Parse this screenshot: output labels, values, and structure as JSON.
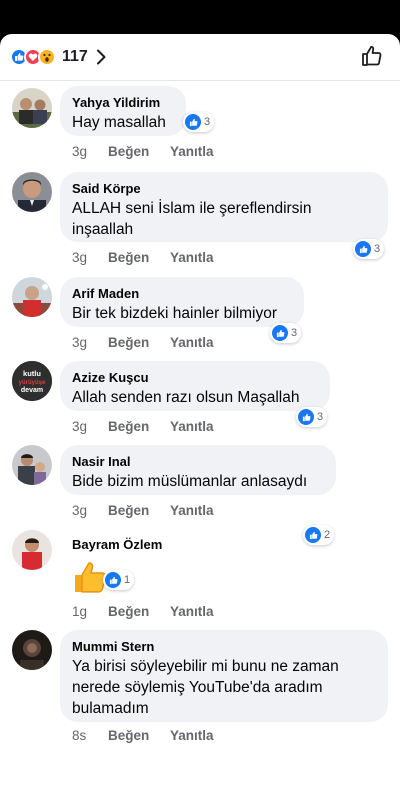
{
  "header": {
    "reaction_count": "117"
  },
  "comments": [
    {
      "name": "Yahya Yildirim",
      "text": "Hay masallah",
      "time": "3g",
      "like": "Beğen",
      "reply": "Yanıtla",
      "reactions": "3"
    },
    {
      "name": "Said Körpe",
      "text": "ALLAH seni İslam ile şereflendirsin inşaallah",
      "time": "3g",
      "like": "Beğen",
      "reply": "Yanıtla",
      "reactions": "3"
    },
    {
      "name": "Arif Maden",
      "text": "Bir tek bizdeki hainler bilmiyor",
      "time": "3g",
      "like": "Beğen",
      "reply": "Yanıtla",
      "reactions": "3"
    },
    {
      "name": "Azize Kuşcu",
      "text": "Allah senden razı olsun  Maşallah",
      "time": "3g",
      "like": "Beğen",
      "reply": "Yanıtla",
      "reactions": "3",
      "avatar_text": "kutlu yürüyüşe devam"
    },
    {
      "name": "Nasir Inal",
      "text": "Bide bizim müslümanlar anlasaydı",
      "time": "3g",
      "like": "Beğen",
      "reply": "Yanıtla",
      "reactions": "2"
    },
    {
      "name": "Bayram Özlem",
      "text": "",
      "time": "1g",
      "like": "Beğen",
      "reply": "Yanıtla",
      "reactions": "1"
    },
    {
      "name": "Mummi Stern",
      "text": "Ya birisi söyleyebilir mi bunu ne zaman nerede söylemiş YouTube'da aradım bulamadım",
      "time": "8s",
      "like": "Beğen",
      "reply": "Yanıtla"
    }
  ]
}
